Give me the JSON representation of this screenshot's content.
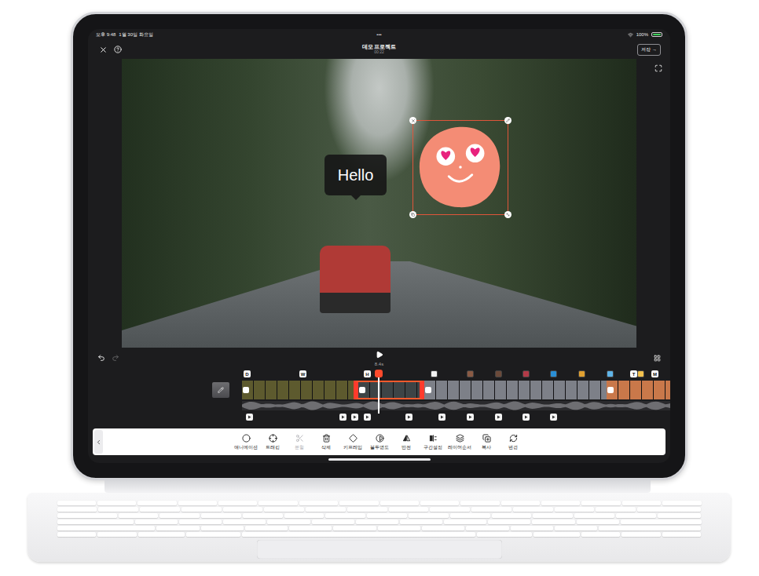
{
  "status_bar": {
    "time": "오후 9:48",
    "date": "1월 30일 화요일",
    "dots": "•••",
    "battery": "100%",
    "battery_level": 1
  },
  "header": {
    "title": "데모 프로젝트",
    "subtitle": "00:22",
    "save": "저장 →"
  },
  "history": {
    "can_undo": true,
    "can_redo": false
  },
  "canvas": {
    "text_overlay": "Hello",
    "sticker": {
      "selected": true
    }
  },
  "playback": {
    "time": "8.4s"
  },
  "timeline": {
    "top_markers": [
      {
        "kind": "letter",
        "label": "D"
      },
      {
        "kind": "letter",
        "label": "W"
      },
      {
        "kind": "letter",
        "label": "H"
      },
      {
        "kind": "sticker",
        "color": "#f2f2f2"
      },
      {
        "kind": "sticker",
        "color": "#8a5a44"
      },
      {
        "kind": "sticker",
        "color": "#6b4a3a"
      },
      {
        "kind": "sticker",
        "color": "#b23a48"
      },
      {
        "kind": "sticker",
        "color": "#2a8fd6"
      },
      {
        "kind": "sticker",
        "color": "#e0a030"
      },
      {
        "kind": "sticker",
        "color": "#5fb4e8"
      },
      {
        "kind": "letter",
        "label": "T"
      },
      {
        "kind": "sticker",
        "color": "#f2c14e"
      },
      {
        "kind": "letter",
        "label": "M"
      }
    ],
    "clips": [
      {
        "color": "#5d5a2e",
        "selected": false,
        "transition": true
      },
      {
        "color": "#3d4446",
        "selected": true,
        "transition": true
      },
      {
        "color": "#7d8088",
        "selected": false,
        "transition": true
      },
      {
        "color": "#c9784a",
        "selected": false,
        "transition": true
      }
    ]
  },
  "tools": [
    {
      "label": "애니메이션",
      "disabled": false
    },
    {
      "label": "트래킹",
      "disabled": false
    },
    {
      "label": "분할",
      "disabled": true
    },
    {
      "label": "삭제",
      "disabled": false
    },
    {
      "label": "키프레임",
      "disabled": false
    },
    {
      "label": "불투명도",
      "disabled": false
    },
    {
      "label": "반전",
      "disabled": false
    },
    {
      "label": "구간설정",
      "disabled": false
    },
    {
      "label": "레이어순서",
      "disabled": false
    },
    {
      "label": "복사",
      "disabled": false
    },
    {
      "label": "변경",
      "disabled": false
    }
  ]
}
